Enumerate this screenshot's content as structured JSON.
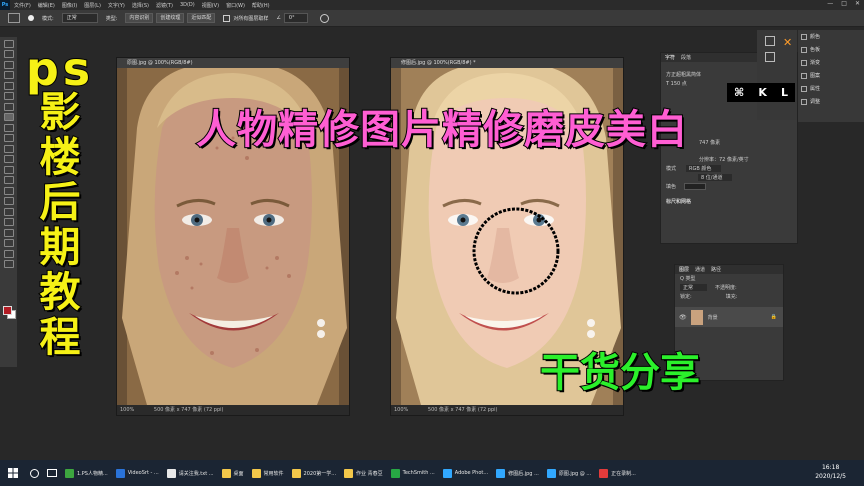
{
  "menubar": {
    "items": [
      "文件(F)",
      "编辑(E)",
      "图像(I)",
      "图层(L)",
      "文字(Y)",
      "选择(S)",
      "滤镜(T)",
      "3D(D)",
      "视图(V)",
      "窗口(W)",
      "帮助(H)"
    ],
    "window_controls": [
      "—",
      "□",
      "✕"
    ]
  },
  "options_bar": {
    "mode_label": "模式:",
    "mode_value": "正常",
    "type_label": "类型:",
    "type_buttons": [
      "内容识别",
      "创建纹理",
      "近似匹配"
    ],
    "sample_all_label": "对所有图层取样",
    "angle": "0°"
  },
  "documents": [
    {
      "tab": "原图.jpg @ 100%(RGB/8#)",
      "zoom": "100%",
      "status": "500 像素 x 747 像素 (72 ppi)"
    },
    {
      "tab": "修图后.jpg @ 100%(RGB/8#) *",
      "zoom": "100%",
      "status": "500 像素 x 747 像素 (72 ppi)"
    }
  ],
  "character_panel": {
    "tabs": [
      "字符",
      "段落"
    ],
    "font": "方正超粗黑简体",
    "size_row": "T 150 点",
    "size_value": "747 像素",
    "resolution": "分辨率：72 像素/英寸",
    "mode_label": "模式",
    "mode_value": "RGB 颜色",
    "channel_value": "8 位/通道",
    "fill_label": "填色",
    "rulers_grid": "标尺和网格"
  },
  "right_strip": {
    "items": [
      "颜色",
      "色板",
      "渐变",
      "图案",
      "属性",
      "调整"
    ]
  },
  "layers_panel": {
    "tabs": [
      "图层",
      "通道",
      "路径"
    ],
    "search": "Q 类型",
    "blend_mode": "正常",
    "opacity_label": "不透明度:",
    "fill_label": "填充:",
    "lock_label": "锁定:",
    "layer_name": "背景"
  },
  "overlay": {
    "vertical_title_ps": "ps",
    "vertical_title_chars": [
      "影",
      "楼",
      "后",
      "期",
      "教",
      "程"
    ],
    "main_title": "人物精修图片精修磨皮美白",
    "green_title": "干货分享",
    "key_hints": [
      "⌘",
      "K",
      "L"
    ]
  },
  "taskbar": {
    "items": [
      {
        "label": "1.PS人物精...",
        "color": "#3da63f"
      },
      {
        "label": "VideoSrt - ...",
        "color": "#2a73d9"
      },
      {
        "label": "请关注我.txt ...",
        "color": "#e8e8e8"
      },
      {
        "label": "桌面",
        "color": "#f3c84a"
      },
      {
        "label": "常用软件",
        "color": "#f3c84a"
      },
      {
        "label": "2020第一学...",
        "color": "#f3c84a"
      },
      {
        "label": "作业 青春豆",
        "color": "#f3c84a"
      },
      {
        "label": "TechSmith ...",
        "color": "#27a844"
      },
      {
        "label": "Adobe Phot...",
        "color": "#31a8ff"
      },
      {
        "label": "修图后.jpg ...",
        "color": "#31a8ff"
      },
      {
        "label": "原图.jpg @ ...",
        "color": "#31a8ff"
      },
      {
        "label": "正在录制...",
        "color": "#e23b3b"
      }
    ],
    "time": "16:18",
    "date": "2020/12/5"
  }
}
